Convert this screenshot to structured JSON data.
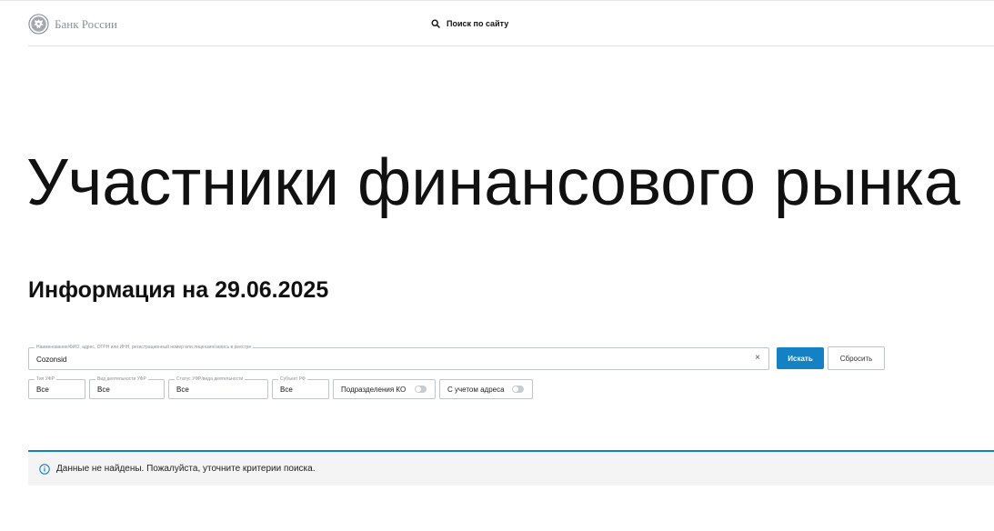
{
  "header": {
    "logo_text": "Банк России",
    "search_label": "Поиск по сайту"
  },
  "page": {
    "title": "Участники финансового рынка",
    "info_title": "Информация на 29.06.2025"
  },
  "search": {
    "legend": "Наименование/ФИО, адрес, ОГРН или ИНН, регистрационный номер или лицензия/запись в реестре",
    "value": "Cozonsid",
    "clear_symbol": "×",
    "search_button": "Искать",
    "reset_button": "Сбросить"
  },
  "filters": [
    {
      "legend": "Тип УФР",
      "value": "Все"
    },
    {
      "legend": "Вид деятельности УФР",
      "value": "Все"
    },
    {
      "legend": "Статус УФР/вида деятельности",
      "value": "Все"
    },
    {
      "legend": "Субъект РФ",
      "value": "Все"
    }
  ],
  "toggles": [
    {
      "label": "Подразделения КО",
      "checked": false
    },
    {
      "label": "С учетом адреса",
      "checked": false
    }
  ],
  "notice": {
    "icon": "info-icon",
    "text": "Данные не найдены. Пожалуйста, уточните критерии поиска."
  },
  "colors": {
    "accent": "#1481c5",
    "notice_bg": "#f4f4f5",
    "border": "#bfc4c9"
  }
}
